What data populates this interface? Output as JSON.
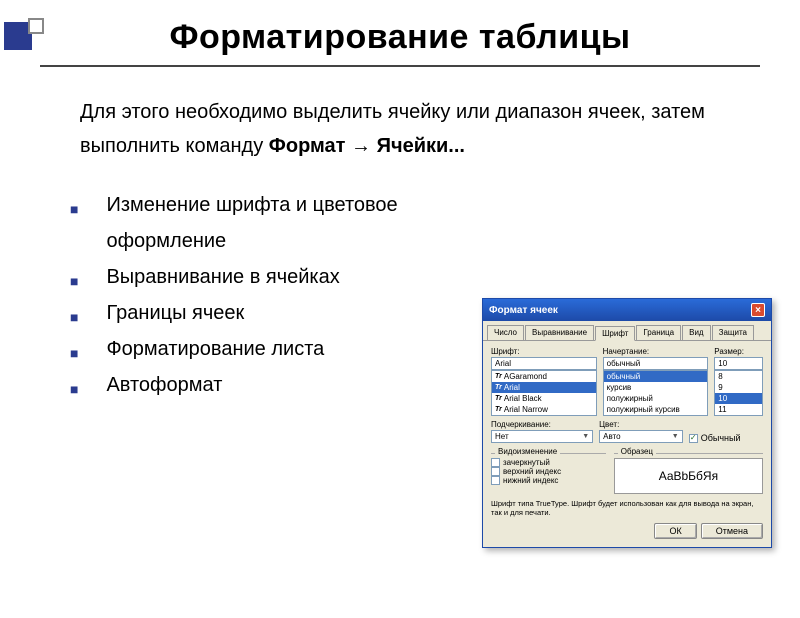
{
  "title": "Форматирование таблицы",
  "intro_part1": "Для этого необходимо выделить ячейку или диапазон ячеек, затем выполнить команду ",
  "intro_bold": "Формат → Ячейки...",
  "bullets": [
    "Изменение шрифта и цветовое оформление",
    "Выравнивание в ячейках",
    "Границы ячеек",
    "Форматирование листа",
    "Автоформат"
  ],
  "dialog": {
    "title": "Формат ячеек",
    "tabs": [
      "Число",
      "Выравнивание",
      "Шрифт",
      "Граница",
      "Вид",
      "Защита"
    ],
    "active_tab": 2,
    "font_label": "Шрифт:",
    "font_value": "Arial",
    "font_list": [
      "AGaramond",
      "Arial",
      "Arial Black",
      "Arial Narrow"
    ],
    "style_label": "Начертание:",
    "style_value": "обычный",
    "style_list": [
      "обычный",
      "курсив",
      "полужирный",
      "полужирный курсив"
    ],
    "size_label": "Размер:",
    "size_value": "10",
    "size_list": [
      "8",
      "9",
      "10",
      "11"
    ],
    "underline_label": "Подчеркивание:",
    "underline_value": "Нет",
    "color_label": "Цвет:",
    "color_value": "Авто",
    "normal_checkbox": "Обычный",
    "normal_checked": true,
    "effects_label": "Видоизменение",
    "effects": [
      "зачеркнутый",
      "верхний индекс",
      "нижний индекс"
    ],
    "sample_label": "Образец",
    "sample_text": "АаВbБбЯя",
    "note": "Шрифт типа TrueType. Шрифт будет использован как для вывода на экран, так и для печати.",
    "ok": "ОК",
    "cancel": "Отмена"
  }
}
